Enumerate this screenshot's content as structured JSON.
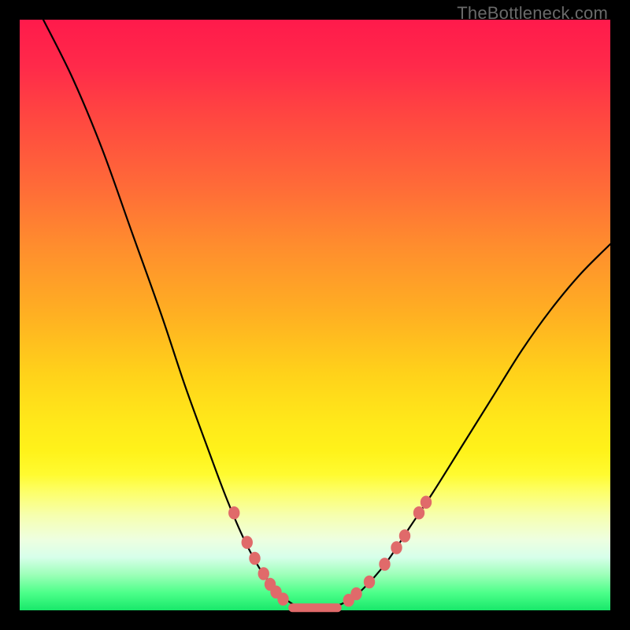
{
  "watermark": "TheBottleneck.com",
  "chart_data": {
    "type": "line",
    "title": "",
    "xlabel": "",
    "ylabel": "",
    "xlim": [
      0,
      100
    ],
    "ylim": [
      0,
      100
    ],
    "grid": false,
    "curve": [
      {
        "x": 4,
        "y": 100
      },
      {
        "x": 9,
        "y": 90
      },
      {
        "x": 14,
        "y": 78
      },
      {
        "x": 19,
        "y": 64
      },
      {
        "x": 24,
        "y": 50
      },
      {
        "x": 28,
        "y": 38
      },
      {
        "x": 32,
        "y": 27
      },
      {
        "x": 35,
        "y": 19
      },
      {
        "x": 38,
        "y": 12
      },
      {
        "x": 41,
        "y": 6.5
      },
      {
        "x": 44,
        "y": 2.8
      },
      {
        "x": 46,
        "y": 1.2
      },
      {
        "x": 47.5,
        "y": 0.6
      },
      {
        "x": 50,
        "y": 0.5
      },
      {
        "x": 52.5,
        "y": 0.6
      },
      {
        "x": 55,
        "y": 1.3
      },
      {
        "x": 58,
        "y": 3.5
      },
      {
        "x": 62,
        "y": 8
      },
      {
        "x": 66,
        "y": 14
      },
      {
        "x": 70,
        "y": 20
      },
      {
        "x": 75,
        "y": 28
      },
      {
        "x": 80,
        "y": 36
      },
      {
        "x": 85,
        "y": 44
      },
      {
        "x": 90,
        "y": 51
      },
      {
        "x": 95,
        "y": 57
      },
      {
        "x": 100,
        "y": 62
      }
    ],
    "floor_segment": {
      "x_start": 45.5,
      "x_end": 54.5,
      "y": 0.5
    },
    "left_dots": [
      {
        "x": 36.3,
        "y": 16.5
      },
      {
        "x": 38.5,
        "y": 11.5
      },
      {
        "x": 39.8,
        "y": 8.8
      },
      {
        "x": 41.3,
        "y": 6.2
      },
      {
        "x": 42.4,
        "y": 4.4
      },
      {
        "x": 43.4,
        "y": 3.1
      },
      {
        "x": 44.6,
        "y": 1.9
      }
    ],
    "right_dots": [
      {
        "x": 55.7,
        "y": 1.7
      },
      {
        "x": 57.0,
        "y": 2.8
      },
      {
        "x": 59.2,
        "y": 4.8
      },
      {
        "x": 61.8,
        "y": 7.8
      },
      {
        "x": 63.8,
        "y": 10.6
      },
      {
        "x": 65.2,
        "y": 12.6
      },
      {
        "x": 67.6,
        "y": 16.5
      },
      {
        "x": 68.8,
        "y": 18.3
      }
    ],
    "colors": {
      "dot": "#e06a6a",
      "curve": "#000000",
      "frame": "#000000"
    }
  }
}
